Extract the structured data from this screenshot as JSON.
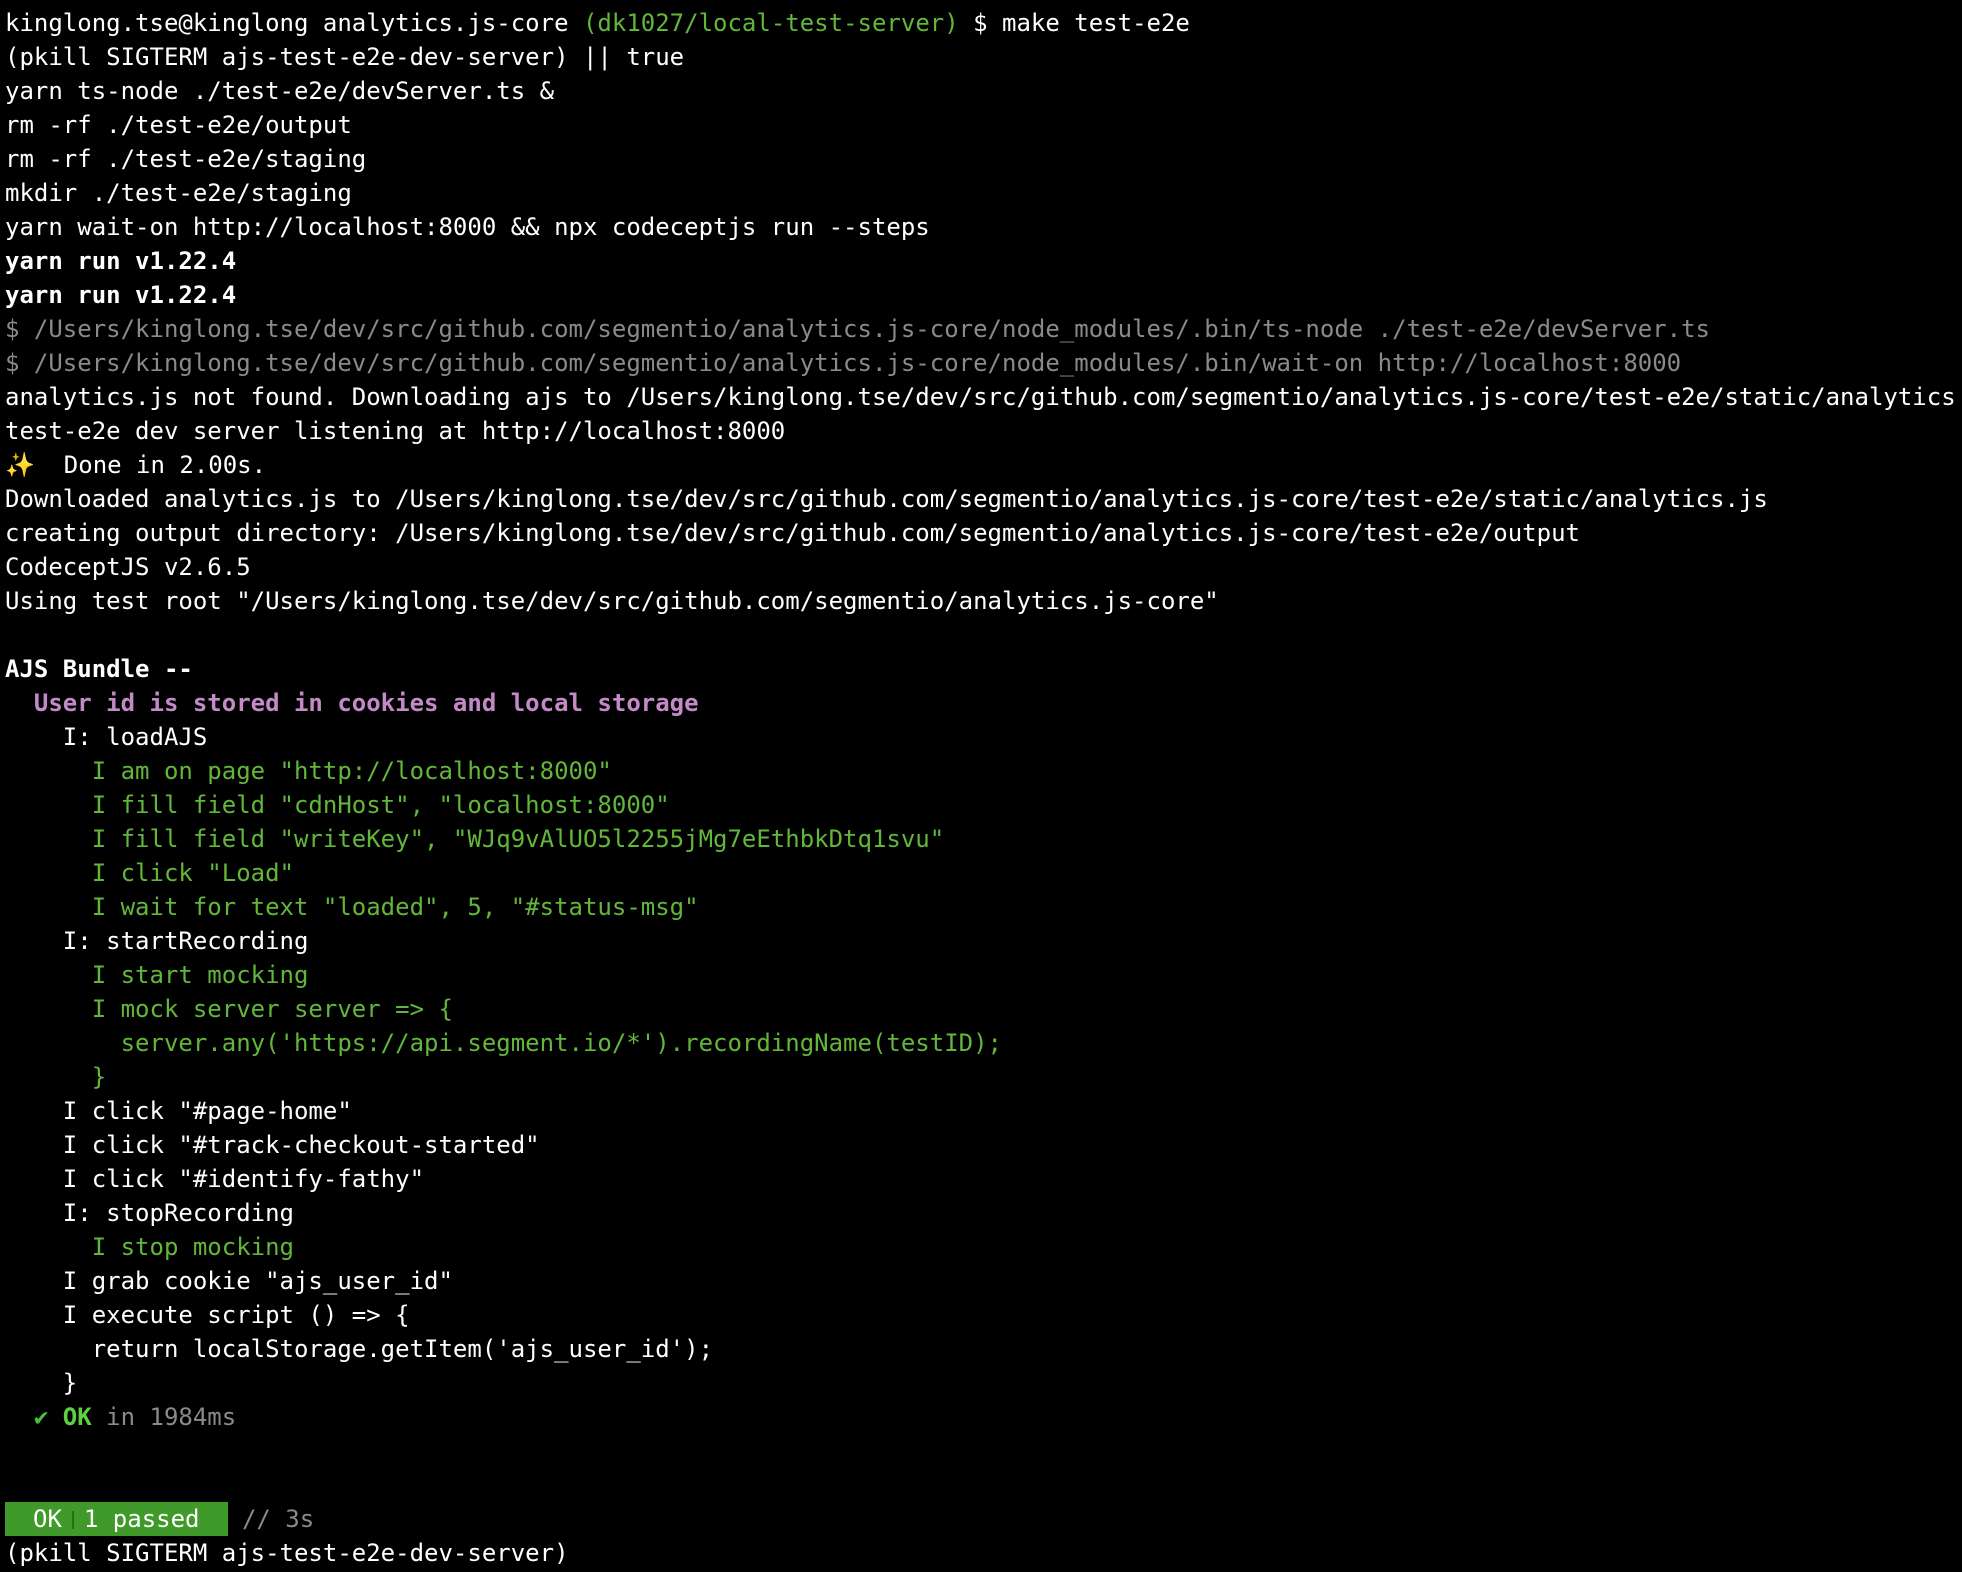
{
  "prompt": {
    "user_host": "kinglong.tse@kinglong",
    "dir": "analytics.js-core",
    "branch": "(dk1027/local-test-server)",
    "symbol": "$",
    "command": "make test-e2e"
  },
  "output": {
    "pkill": "(pkill SIGTERM ajs-test-e2e-dev-server) || true",
    "ts_node": "yarn ts-node ./test-e2e/devServer.ts &",
    "rm_output": "rm -rf ./test-e2e/output",
    "rm_staging": "rm -rf ./test-e2e/staging",
    "mkdir_staging": "mkdir ./test-e2e/staging",
    "wait_on": "yarn wait-on http://localhost:8000 && npx codeceptjs run --steps",
    "yarn_run_1": "yarn run v1.22.4",
    "yarn_run_2": "yarn run v1.22.4",
    "dollar_ts_node": "$ /Users/kinglong.tse/dev/src/github.com/segmentio/analytics.js-core/node_modules/.bin/ts-node ./test-e2e/devServer.ts",
    "dollar_wait_on": "$ /Users/kinglong.tse/dev/src/github.com/segmentio/analytics.js-core/node_modules/.bin/wait-on http://localhost:8000",
    "not_found": "analytics.js not found. Downloading ajs to /Users/kinglong.tse/dev/src/github.com/segmentio/analytics.js-core/test-e2e/static/analytics.js",
    "listening": "test-e2e dev server listening at http://localhost:8000",
    "sparkles_icon": "✨",
    "done": "  Done in 2.00s.",
    "downloaded": "Downloaded analytics.js to /Users/kinglong.tse/dev/src/github.com/segmentio/analytics.js-core/test-e2e/static/analytics.js",
    "creating_output": "creating output directory: /Users/kinglong.tse/dev/src/github.com/segmentio/analytics.js-core/test-e2e/output",
    "codecept_version": "CodeceptJS v2.6.5",
    "test_root": "Using test root \"/Users/kinglong.tse/dev/src/github.com/segmentio/analytics.js-core\""
  },
  "suite": {
    "title": "AJS Bundle --",
    "scenario": "  User id is stored in cookies and local storage",
    "steps": [
      "    I: loadAJS",
      "      I am on page \"http://localhost:8000\"",
      "      I fill field \"cdnHost\", \"localhost:8000\"",
      "      I fill field \"writeKey\", \"WJq9vAlUO5l2255jMg7eEthbkDtq1svu\"",
      "      I click \"Load\"",
      "      I wait for text \"loaded\", 5, \"#status-msg\"",
      "    I: startRecording",
      "      I start mocking",
      "      I mock server server => {",
      "        server.any('https://api.segment.io/*').recordingName(testID);",
      "      }",
      "    I click \"#page-home\"",
      "    I click \"#track-checkout-started\"",
      "    I click \"#identify-fathy\"",
      "    I: stopRecording",
      "      I stop mocking",
      "    I grab cookie \"ajs_user_id\"",
      "    I execute script () => {",
      "      return localStorage.getItem('ajs_user_id');",
      "    }"
    ],
    "result_check": "  ✔ ",
    "result_ok": "OK",
    "result_time": " in 1984ms"
  },
  "summary": {
    "ok": "OK",
    "passed": "1 passed",
    "duration": " // 3s",
    "pkill_final": "(pkill SIGTERM ajs-test-e2e-dev-server)"
  },
  "colors": {
    "background": "#000000",
    "text": "#ffffff",
    "branch": "#62b73a",
    "step": "#62b73a",
    "dim": "#8a8a8a",
    "scenario": "#c48ac8",
    "badge": "#3f9a2a"
  }
}
